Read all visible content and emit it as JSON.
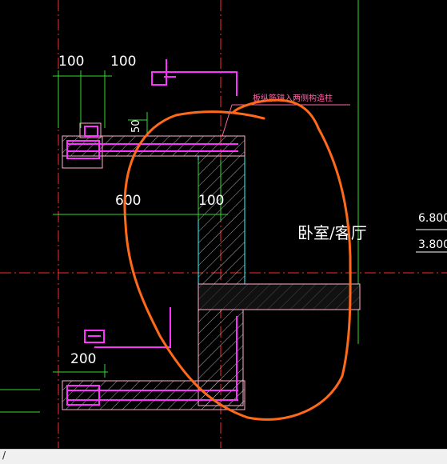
{
  "drawing": {
    "dimensions": {
      "top_left": "100",
      "top_right": "100",
      "small": "50",
      "span": "600",
      "wall": "100",
      "bottom": "200"
    },
    "note": "板纵筋锚入两侧构造柱",
    "room_label": "卧室/客厅",
    "elevations": [
      "6.800",
      "3.800"
    ]
  },
  "colors": {
    "background": "#000000",
    "axis": "#ff2a2a",
    "concrete": "#ffb0d0",
    "rebar": "#ff33ff",
    "dimension": "#33dd33",
    "cyan": "#33ffff",
    "annotation_circle": "#ff6a1a"
  },
  "statusbar": {
    "text": "/"
  }
}
